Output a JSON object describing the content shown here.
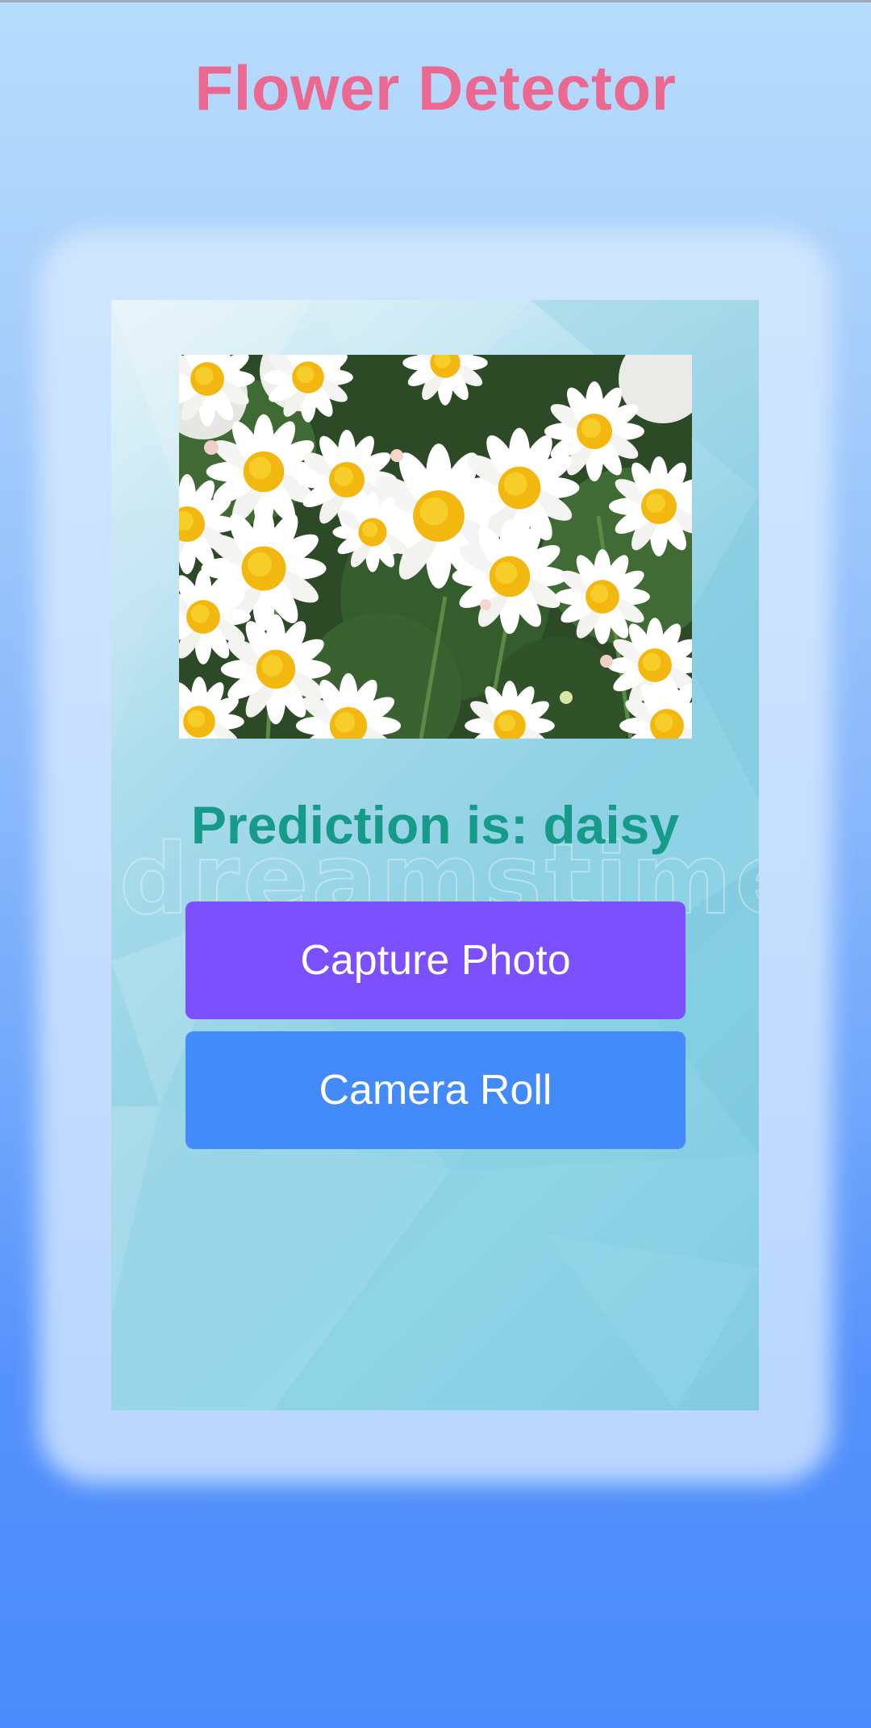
{
  "app": {
    "title": "Flower Detector"
  },
  "result": {
    "prediction_text": "Prediction is: daisy"
  },
  "image": {
    "description_icon": "flower-photo",
    "watermark": "dreamstime"
  },
  "actions": {
    "capture_label": "Capture Photo",
    "camera_roll_label": "Camera Roll"
  },
  "colors": {
    "title": "#eb6890",
    "prediction": "#169a8a",
    "capture_button": "#7c50fc",
    "camera_roll_button": "#438bfb"
  }
}
